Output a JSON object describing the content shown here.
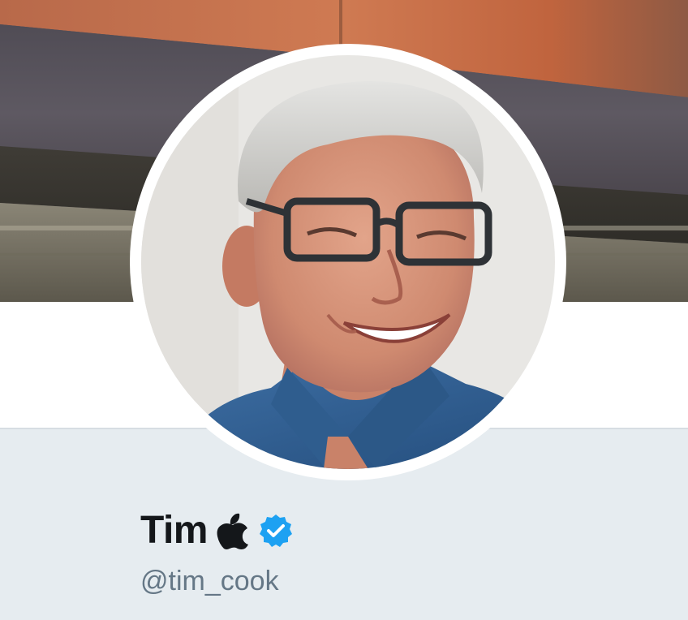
{
  "profile": {
    "display_name": "Tim",
    "handle": "@tim_cook",
    "verified": true,
    "name_emoji": "apple-logo-icon"
  },
  "header_image": {
    "description_icon": "banner-photo"
  },
  "avatar": {
    "icon": "profile-photo"
  },
  "colors": {
    "verified_blue": "#1da1f2",
    "name_text": "#14171a",
    "handle_text": "#657786",
    "page_bg": "#e6ecf0",
    "card_bg": "#ffffff",
    "banner_orange": "#c9714a",
    "banner_gray": "#5c5860"
  }
}
